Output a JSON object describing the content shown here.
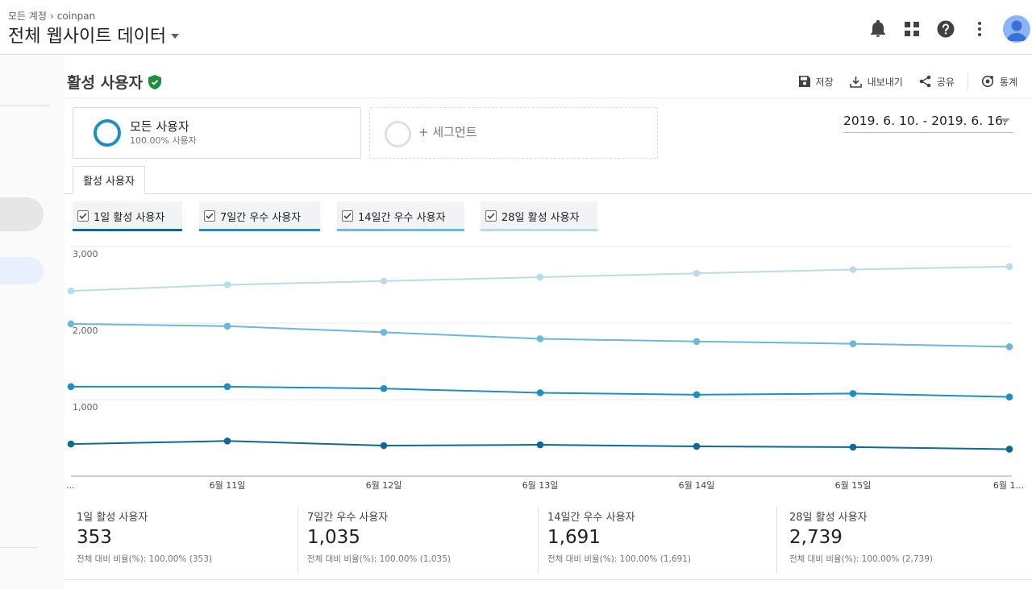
{
  "header": {
    "breadcrumb": [
      "모든 계정",
      "coinpan"
    ],
    "breadcrumb_sep": "›",
    "view_title": "전체 웹사이트 데이터",
    "icons": [
      "bell-icon",
      "apps-grid-icon",
      "help-icon",
      "more-vert-icon",
      "avatar-icon"
    ]
  },
  "report": {
    "title": "활성 사용자",
    "verified_icon": "shield-check-icon",
    "actions": [
      {
        "label": "저장",
        "icon": "save-icon"
      },
      {
        "label": "내보내기",
        "icon": "download-icon"
      },
      {
        "label": "공유",
        "icon": "share-icon"
      },
      {
        "label": "통계",
        "icon": "insights-icon"
      }
    ]
  },
  "segments": {
    "active": {
      "name": "모든 사용자",
      "pct": "100.00% 사용자"
    },
    "add_label": "+ 세그먼트"
  },
  "date_range": "2019. 6. 10. - 2019. 6. 16.",
  "tab": "활성 사용자",
  "legend": [
    {
      "label": "1일 활성 사용자",
      "color": "#0b6a96"
    },
    {
      "label": "7일간 우수 사용자",
      "color": "#1f8ec2"
    },
    {
      "label": "14일간 우수 사용자",
      "color": "#6ab8da"
    },
    {
      "label": "28일 활성 사용자",
      "color": "#b9dcec"
    }
  ],
  "chart_data": {
    "type": "line",
    "categories": [
      "...",
      "6월 11일",
      "6월 12일",
      "6월 13일",
      "6월 14일",
      "6월 15일",
      "6월 1..."
    ],
    "yticks": [
      "1,000",
      "2,000",
      "3,000"
    ],
    "ylim": [
      0,
      3000
    ],
    "grid": true,
    "series": [
      {
        "name": "1일 활성 사용자",
        "color": "#0b6a96",
        "values": [
          420,
          460,
          400,
          410,
          390,
          380,
          353
        ]
      },
      {
        "name": "7일간 우수 사용자",
        "color": "#1f8ec2",
        "values": [
          1170,
          1170,
          1145,
          1090,
          1065,
          1080,
          1035
        ]
      },
      {
        "name": "14일간 우수 사용자",
        "color": "#6ab8da",
        "values": [
          1990,
          1960,
          1880,
          1795,
          1760,
          1730,
          1691
        ]
      },
      {
        "name": "28일 활성 사용자",
        "color": "#b9dcec",
        "values": [
          2420,
          2500,
          2550,
          2600,
          2650,
          2700,
          2739
        ]
      }
    ]
  },
  "summary": [
    {
      "label": "1일 활성 사용자",
      "value": "353",
      "sub": "전체 대비 비율(%): 100.00% (353)"
    },
    {
      "label": "7일간 우수 사용자",
      "value": "1,035",
      "sub": "전체 대비 비율(%): 100.00% (1,035)"
    },
    {
      "label": "14일간 우수 사용자",
      "value": "1,691",
      "sub": "전체 대비 비율(%): 100.00% (1,691)"
    },
    {
      "label": "28일 활성 사용자",
      "value": "2,739",
      "sub": "전체 대비 비율(%): 100.00% (2,739)"
    }
  ]
}
